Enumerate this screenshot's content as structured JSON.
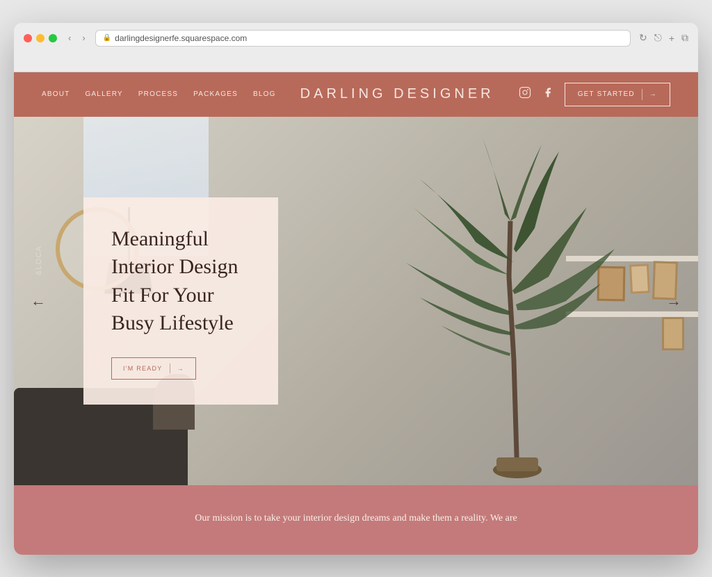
{
  "browser": {
    "url": "darlingdesignerfe.squarespace.com",
    "reload_icon": "↻"
  },
  "nav": {
    "links": [
      "About",
      "Gallery",
      "Process",
      "Packages",
      "Blog"
    ],
    "brand": "Darling Designer",
    "social": [
      "instagram",
      "facebook"
    ],
    "cta_label": "Get Started",
    "cta_arrow": "→"
  },
  "hero": {
    "heading_line1": "Meaningful",
    "heading_line2": "Interior Design",
    "heading_line3": "Fit For Your",
    "heading_line4": "Busy Lifestyle",
    "full_heading": "Meaningful Interior Design Fit For Your Busy Lifestyle",
    "cta_label": "I'm Ready",
    "cta_arrow": "→",
    "arrow_left": "←",
    "arrow_right": "→",
    "deco_text": "&LOCA"
  },
  "mission": {
    "text": "Our mission is to take your interior design dreams and make them a reality. We are"
  },
  "colors": {
    "nav_bg": "#b86a5a",
    "hero_card_bg": "rgba(250,235,228,0.92)",
    "mission_bg": "#c47a7a",
    "text_dark": "#3a2520",
    "text_light": "#f5e6e0",
    "accent": "#b86a5a"
  }
}
